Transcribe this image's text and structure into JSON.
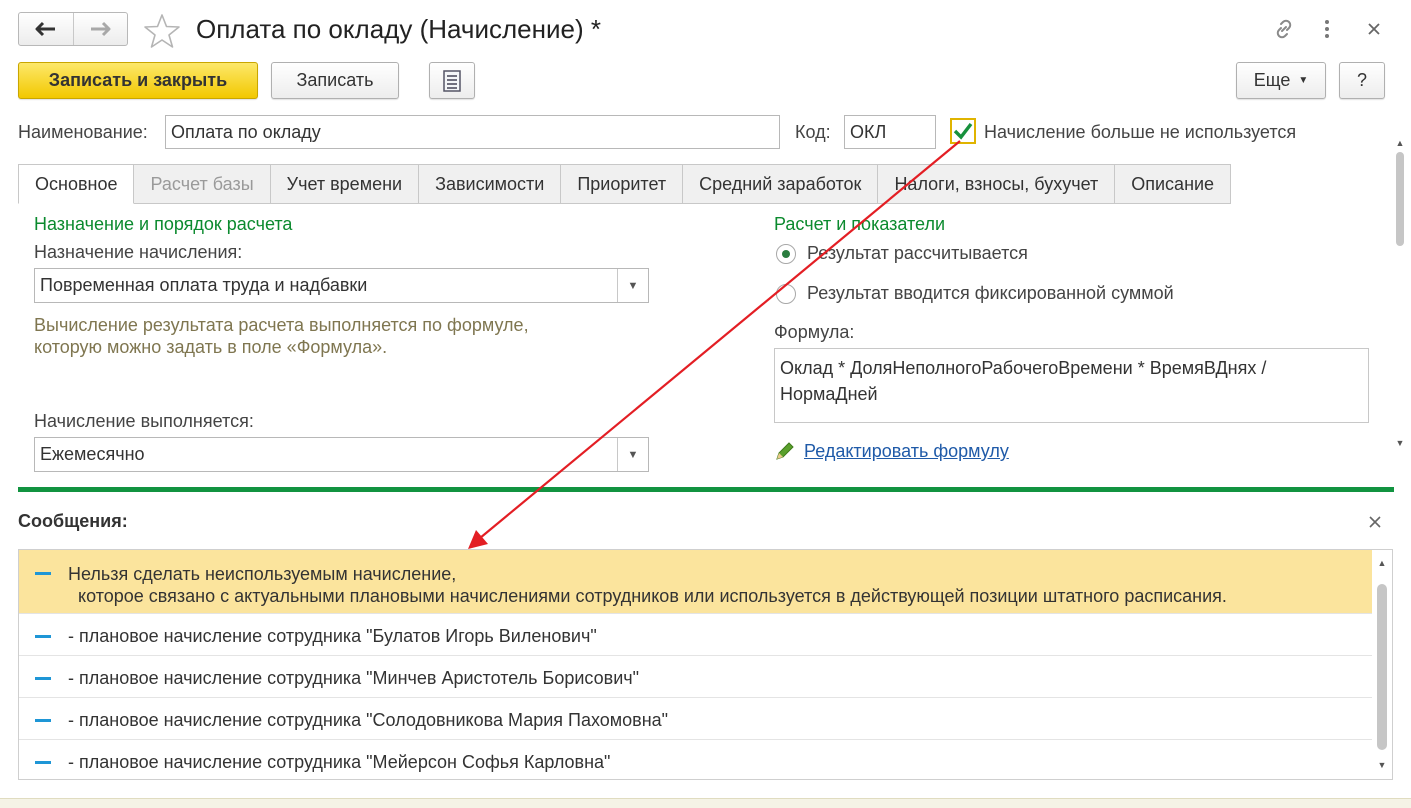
{
  "window": {
    "title": "Оплата по окладу (Начисление) *",
    "icons": [
      "back-arrow-icon",
      "forward-arrow-icon",
      "star-icon",
      "link-icon",
      "more-vertical-icon",
      "close-icon"
    ]
  },
  "toolbar": {
    "save_close_label": "Записать и закрыть",
    "save_label": "Записать",
    "more_label": "Еще",
    "help_label": "?"
  },
  "header": {
    "name_label": "Наименование:",
    "name_value": "Оплата по окладу",
    "code_label": "Код:",
    "code_value": "ОКЛ",
    "unused_checkbox_label": "Начисление больше не используется",
    "unused_checked": true
  },
  "tabs": [
    {
      "label": "Основное",
      "active": true,
      "disabled": false
    },
    {
      "label": "Расчет базы",
      "active": false,
      "disabled": true
    },
    {
      "label": "Учет времени",
      "active": false,
      "disabled": false
    },
    {
      "label": "Зависимости",
      "active": false,
      "disabled": false
    },
    {
      "label": "Приоритет",
      "active": false,
      "disabled": false
    },
    {
      "label": "Средний заработок",
      "active": false,
      "disabled": false
    },
    {
      "label": "Налоги, взносы, бухучет",
      "active": false,
      "disabled": false
    },
    {
      "label": "Описание",
      "active": false,
      "disabled": false
    }
  ],
  "main": {
    "left": {
      "section_title": "Назначение и порядок расчета",
      "purpose_label": "Назначение начисления:",
      "purpose_value": "Повременная оплата труда и надбавки",
      "hint_line1": "Вычисление результата расчета выполняется по формуле,",
      "hint_line2": "которую можно задать в поле «Формула».",
      "performed_label": "Начисление выполняется:",
      "performed_value": "Ежемесячно"
    },
    "right": {
      "section_title": "Расчет и показатели",
      "radio_calculated": "Результат рассчитывается",
      "radio_fixed": "Результат вводится фиксированной суммой",
      "selected_radio": "calculated",
      "formula_label": "Формула:",
      "formula_line1": "Оклад * ДоляНеполногоРабочегоВремени * ВремяВДнях /",
      "formula_line2": "НормаДней",
      "edit_formula_link": "Редактировать формулу"
    }
  },
  "messages": {
    "title": "Сообщения:",
    "items": [
      {
        "line1": "Нельзя сделать неиспользуемым начисление,",
        "line2": "  которое связано с актуальными плановыми начислениями сотрудников или используется в действующей позиции штатного расписания.",
        "highlighted": true
      },
      {
        "line1": "- плановое начисление сотрудника \"Булатов Игорь Виленович\"",
        "highlighted": false
      },
      {
        "line1": "- плановое начисление сотрудника \"Минчев Аристотель Борисович\"",
        "highlighted": false
      },
      {
        "line1": "- плановое начисление сотрудника \"Солодовникова Мария Пахомовна\"",
        "highlighted": false
      },
      {
        "line1": "- плановое начисление сотрудника \"Мейерсон Софья Карловна\"",
        "highlighted": false
      }
    ]
  },
  "colors": {
    "accent_green": "#119340",
    "primary_button": "#f2c800",
    "highlight_row": "#fbe49d",
    "link": "#1f5aa8",
    "annotation_arrow": "#e31e24",
    "message_dash": "#1e96d6"
  }
}
